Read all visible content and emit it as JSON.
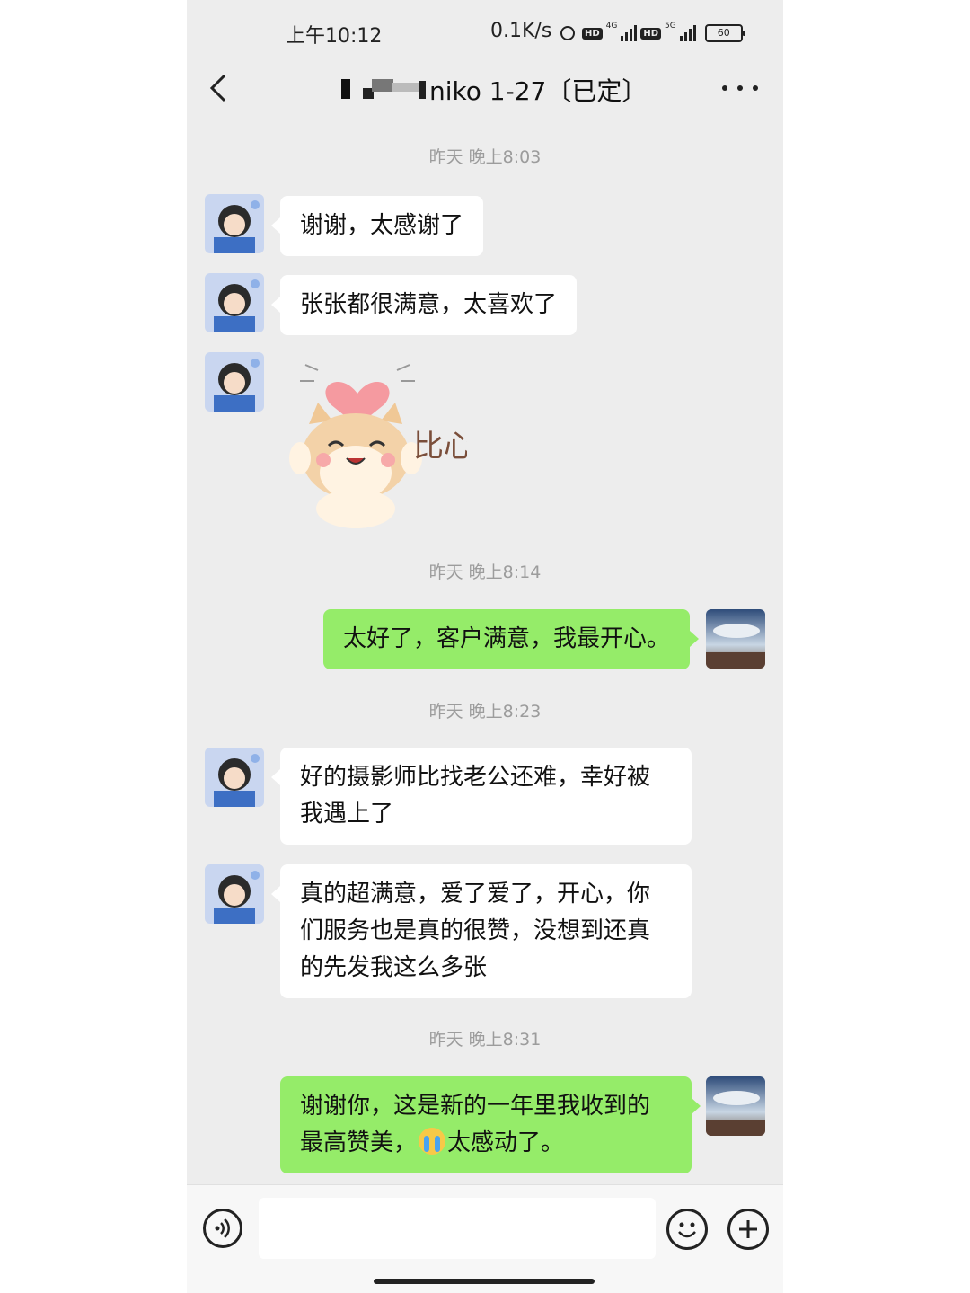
{
  "status_bar": {
    "time": "上午10:12",
    "speed": "0.1K/s",
    "network_1": "4G",
    "network_2": "5G",
    "hd_label": "HD",
    "battery": "60"
  },
  "nav": {
    "title": "niko 1-27〔已定〕",
    "back_icon": "chevron-left-icon",
    "more_icon": "more-dots-icon"
  },
  "timestamps": [
    "昨天 晚上8:03",
    "昨天 晚上8:14",
    "昨天 晚上8:23",
    "昨天 晚上8:31"
  ],
  "messages": [
    {
      "side": "in",
      "text": "谢谢，太感谢了"
    },
    {
      "side": "in",
      "text": "张张都很满意，太喜欢了"
    },
    {
      "side": "in",
      "type": "sticker",
      "sticker_text": "比心"
    },
    {
      "side": "out",
      "text": "太好了，客户满意，我最开心。"
    },
    {
      "side": "in",
      "text_line1": "好的摄影师比找老公还难，幸好被",
      "text_line2": "我遇上了"
    },
    {
      "side": "in",
      "text_line1": "真的超满意，爱了爱了，开心，你",
      "text_line2": "们服务也是真的很赞，没想到还真",
      "text_line3": "的先发我这么多张"
    },
    {
      "side": "out",
      "text_line1": "谢谢你，这是新的一年里我收到的",
      "text_line2_a": "最高赞美，",
      "emoji": "loudly-crying-face",
      "text_line2_b": "太感动了。"
    }
  ],
  "input_bar": {
    "placeholder": "",
    "voice_icon": "voice-icon",
    "emoji_icon": "emoji-icon",
    "plus_icon": "plus-icon"
  },
  "colors": {
    "chat_bg": "#ededed",
    "outgoing_bubble": "#95ec69",
    "incoming_bubble": "#ffffff"
  }
}
